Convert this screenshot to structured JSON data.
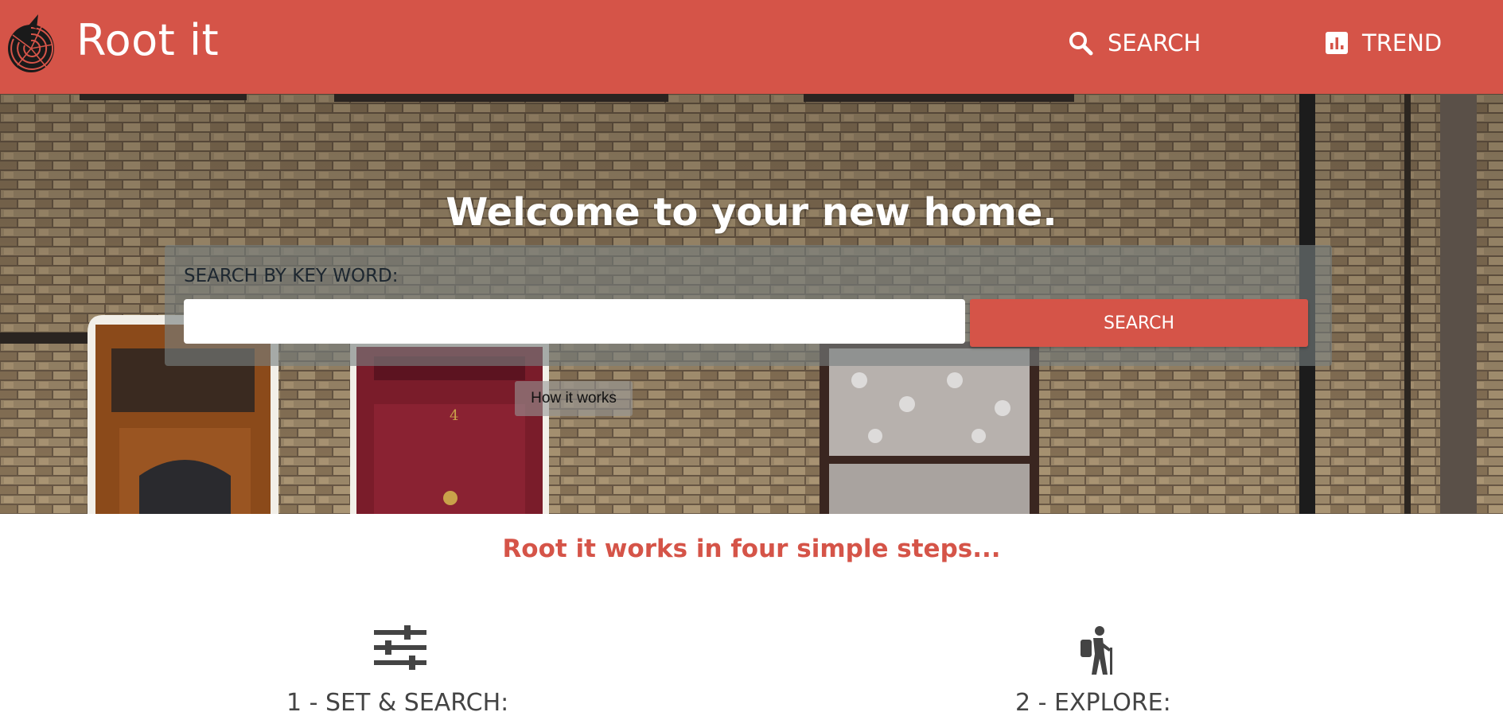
{
  "colors": {
    "brand": "#d55448",
    "white": "#ffffff",
    "panel": "rgba(120,128,128,0.62)",
    "icon_dark": "#444444"
  },
  "header": {
    "brand": "Root it",
    "logo_icon": "nautilus-shell-icon",
    "nav": [
      {
        "label": "SEARCH",
        "icon": "search-icon"
      },
      {
        "label": "TREND",
        "icon": "bar-chart-icon"
      }
    ]
  },
  "hero": {
    "title": "Welcome to your new home.",
    "search": {
      "label": "SEARCH BY KEY WORD:",
      "input_value": "",
      "placeholder": "",
      "button": "SEARCH"
    },
    "how_it_works": "How it works",
    "background": "brick-terrace-houses-photo"
  },
  "steps": {
    "title": "Root it works in four simple steps...",
    "items": [
      {
        "label": "1 - SET & SEARCH:",
        "icon": "sliders-icon"
      },
      {
        "label": "2 - EXPLORE:",
        "icon": "hiker-icon"
      }
    ]
  }
}
